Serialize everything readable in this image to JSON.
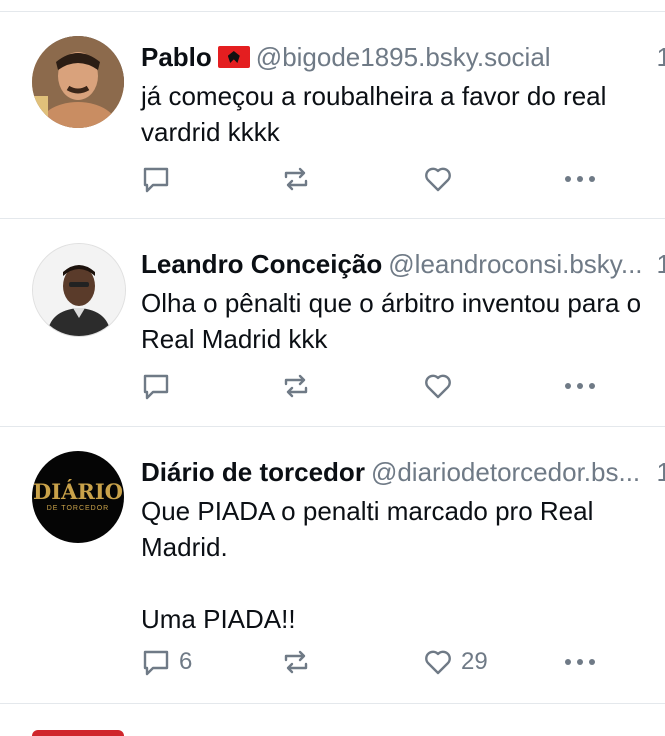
{
  "posts": [
    {
      "name": "Pablo",
      "flag": "albania-flag",
      "handle": "@bigode1895.bsky.social",
      "time": "1",
      "text": "já começou a roubalheira a favor do real vardrid kkkk",
      "replies": "",
      "likes": ""
    },
    {
      "name": "Leandro Conceição",
      "handle": "@leandroconsi.bsky...",
      "time": "1",
      "text": "Olha o pênalti que o árbitro inventou para o\nReal Madrid kkk",
      "replies": "",
      "likes": ""
    },
    {
      "name": "Diário de torcedor",
      "handle": "@diariodetorcedor.bs...",
      "time": "1",
      "text": "Que PIADA o penalti marcado pro Real\nMadrid.\n\nUma PIADA!!",
      "replies": "6",
      "likes": "29",
      "avatar_logo": "DIÁRIO",
      "avatar_sub": "DE TORCEDOR"
    }
  ],
  "icons": {
    "reply": "reply-icon",
    "repost": "repost-icon",
    "like": "heart-icon",
    "more": "more-icon"
  },
  "colors": {
    "muted": "#6f7a86",
    "divider": "#e4e8ec",
    "text": "#0b0f14",
    "accent_gold": "#c9a24a"
  }
}
